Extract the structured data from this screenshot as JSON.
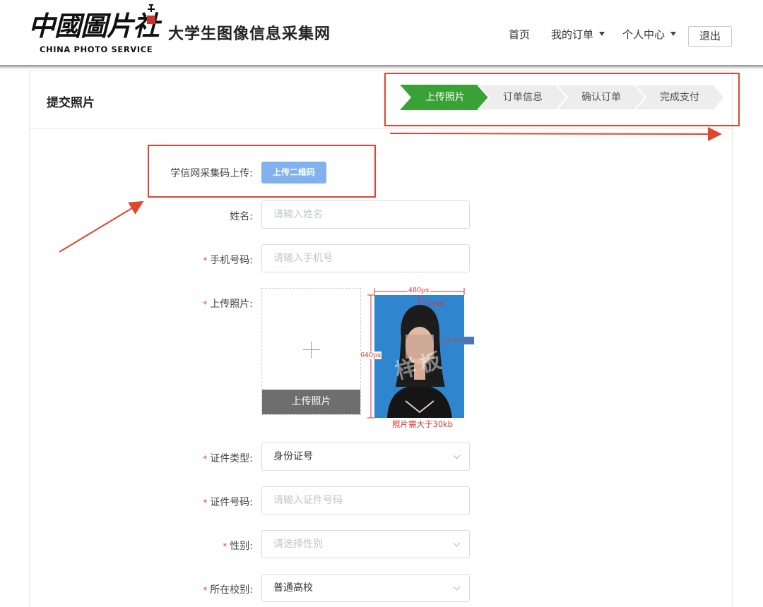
{
  "header": {
    "logo_cn": "中國圖片社",
    "logo_en": "CHINA PHOTO SERVICE",
    "site_title": "大学生图像信息采集网",
    "nav": {
      "home": "首页",
      "orders": "我的订单",
      "personal_center": "个人中心",
      "logout": "退出"
    }
  },
  "page": {
    "title": "提交照片"
  },
  "steps": [
    {
      "label": "上传照片",
      "active": true
    },
    {
      "label": "订单信息",
      "active": false
    },
    {
      "label": "确认订单",
      "active": false
    },
    {
      "label": "完成支付",
      "active": false
    }
  ],
  "colors": {
    "step_active": "#3aa136",
    "step_idle": "#ededed",
    "annotation": "#e0452f",
    "qr_button": "#7fb2ee"
  },
  "form": {
    "qr_upload": {
      "label": "学信网采集码上传:",
      "button": "上传二维码"
    },
    "name": {
      "label": "姓名:",
      "placeholder": "请输入姓名"
    },
    "phone": {
      "label": "手机号码:",
      "placeholder": "请输入手机号",
      "required": "*"
    },
    "photo": {
      "label": "上传照片:",
      "required": "*",
      "upload_button": "上传照片",
      "sample": {
        "width_label": "480px",
        "height_label": "640px",
        "top_margin_label": "7-9mm",
        "side_margin_label": "9-11mm",
        "watermark": "样板",
        "note": "照片需大于30kb"
      }
    },
    "id_type": {
      "label": "证件类型:",
      "value": "身份证号",
      "required": "*"
    },
    "id_number": {
      "label": "证件号码:",
      "placeholder": "请输入证件号码",
      "required": "*"
    },
    "gender": {
      "label": "性别:",
      "placeholder": "请选择性别",
      "required": "*"
    },
    "school": {
      "label": "所在校别:",
      "value": "普通高校",
      "required": "*"
    }
  }
}
